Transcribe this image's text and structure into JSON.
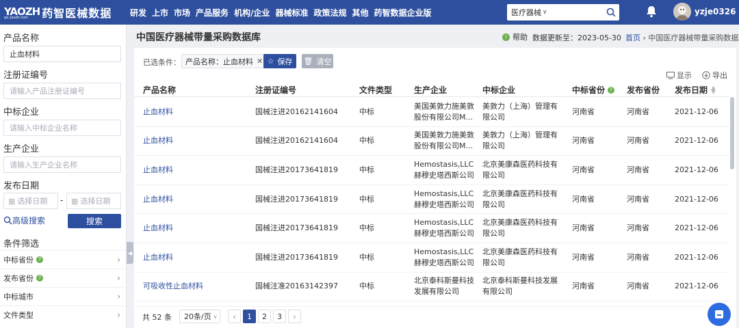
{
  "brand": {
    "logo": "YAOZH",
    "logo_sub": "qx.yaozh.com",
    "name": "药智医械数据"
  },
  "nav": [
    "研发",
    "上市",
    "市场",
    "产品服务",
    "机构/企业",
    "器械标准",
    "政策法规",
    "其他",
    "药智数据企业版"
  ],
  "search": {
    "category": "医疗器械"
  },
  "user": {
    "name": "yzje0326"
  },
  "sidebar": {
    "product_name_label": "产品名称",
    "product_name_value": "止血材料",
    "reg_no_label": "注册证编号",
    "reg_no_placeholder": "请输入产品注册证编号",
    "winner_label": "中标企业",
    "winner_placeholder": "请输入中标企业名称",
    "maker_label": "生产企业",
    "maker_placeholder": "请输入生产企业名称",
    "date_label": "发布日期",
    "date_placeholder": "选择日期",
    "date_sep": "-",
    "advanced": "高级搜索",
    "search_btn": "搜索",
    "filter_title": "条件筛选",
    "filters": [
      "中标省份",
      "发布省份",
      "中标城市",
      "文件类型"
    ]
  },
  "page": {
    "title": "中国医疗器械带量采购数据库",
    "help": "帮助",
    "updated": "数据更新至：2023-05-30",
    "crumb_home": "首页",
    "crumb_sep": "›",
    "crumb_current": "中国医疗器械带量采购数据库"
  },
  "toolbar": {
    "selected_label": "已选条件：",
    "tag": "产品名称：止血材料",
    "save": "保存",
    "clear": "清空",
    "display": "显示",
    "export": "导出"
  },
  "table": {
    "headers": [
      "产品名称",
      "注册证编号",
      "文件类型",
      "生产企业",
      "中标企业",
      "中标省份",
      "发布省份",
      "发布日期"
    ],
    "rows": [
      [
        "止血材料",
        "国械注进20162141604",
        "中标",
        "美国美敦力施美敦股份有限公司M...",
        "美敦力（上海）管理有限公司",
        "河南省",
        "河南省",
        "2021-12-06"
      ],
      [
        "止血材料",
        "国械注进20162141604",
        "中标",
        "美国美敦力施美敦股份有限公司M...",
        "美敦力（上海）管理有限公司",
        "河南省",
        "河南省",
        "2021-12-06"
      ],
      [
        "止血材料",
        "国械注进20173641819",
        "中标",
        "Hemostasis,LLC 赫穆史塔西斯公司",
        "北京美康森医药科技有限公司",
        "河南省",
        "河南省",
        "2021-12-06"
      ],
      [
        "止血材料",
        "国械注进20173641819",
        "中标",
        "Hemostasis,LLC 赫穆史塔西斯公司",
        "北京美康森医药科技有限公司",
        "河南省",
        "河南省",
        "2021-12-06"
      ],
      [
        "止血材料",
        "国械注进20173641819",
        "中标",
        "Hemostasis,LLC 赫穆史塔西斯公司",
        "北京美康森医药科技有限公司",
        "河南省",
        "河南省",
        "2021-12-06"
      ],
      [
        "止血材料",
        "国械注进20173641819",
        "中标",
        "Hemostasis,LLC 赫穆史塔西斯公司",
        "北京美康森医药科技有限公司",
        "河南省",
        "河南省",
        "2021-12-06"
      ],
      [
        "可吸收性止血材料",
        "国械注准20163142397",
        "中标",
        "北京泰科斯曼科技发展有限公司",
        "北京泰科斯曼科技发展有限公司",
        "河南省",
        "河南省",
        "2021-12-06"
      ]
    ]
  },
  "pagination": {
    "total": "共 52 条",
    "page_size": "20条/页",
    "prev": "‹",
    "next": "›",
    "pages": [
      "1",
      "2",
      "3"
    ]
  }
}
